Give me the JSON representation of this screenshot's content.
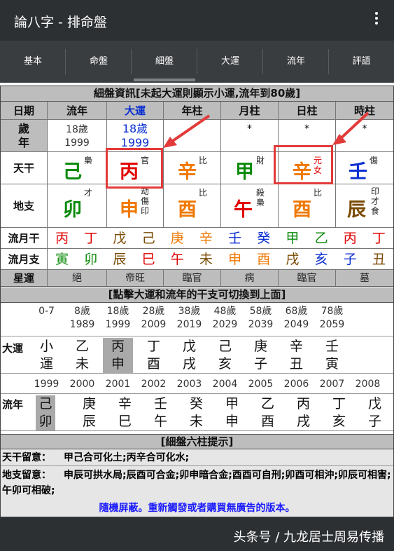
{
  "app": {
    "title": "論八字 - 排命盤"
  },
  "tabs": [
    "基本",
    "命盤",
    "細盤",
    "大運",
    "流年",
    "評語"
  ],
  "active_tab": 2,
  "detail": {
    "header": "細盤資訊[未起大運則顯示小運,流年到80歲]",
    "col_headers": [
      "日期",
      "流年",
      "大運",
      "年柱",
      "月柱",
      "日柱",
      "時柱"
    ],
    "age_row": {
      "label": "歲\n年",
      "liunian": "18歲\n1999",
      "dayun": "18歲\n1999",
      "year": "",
      "month": "*",
      "day": "*",
      "hour": "*"
    },
    "tiangan": {
      "label": "天干",
      "cells": [
        {
          "ch": "己",
          "sup": "梟",
          "color": "#0a8a0a"
        },
        {
          "ch": "丙",
          "sup": "官",
          "color": "#e00000"
        },
        {
          "ch": "辛",
          "sup": "比",
          "color": "#f07800"
        },
        {
          "ch": "甲",
          "sup": "財",
          "color": "#0a8a0a"
        },
        {
          "ch": "辛",
          "sup": "元\n女",
          "color": "#f07800"
        },
        {
          "ch": "壬",
          "sup": "傷",
          "color": "#0a2fd1"
        }
      ]
    },
    "dizhi": {
      "label": "地支",
      "cells": [
        {
          "ch": "卯",
          "sup": "才",
          "color": "#0a8a0a"
        },
        {
          "ch": "申",
          "sup": "劫\n傷\n印",
          "color": "#f07800"
        },
        {
          "ch": "酉",
          "sup": "比",
          "color": "#f07800"
        },
        {
          "ch": "午",
          "sup": "殺\n梟",
          "color": "#e00000"
        },
        {
          "ch": "酉",
          "sup": "比",
          "color": "#f07800"
        },
        {
          "ch": "辰",
          "sup": "印\n才\n食",
          "color": "#7a4a00"
        }
      ]
    },
    "liuyue_gan": {
      "label": "流月干",
      "items": [
        "丙",
        "丁",
        "戊",
        "己",
        "庚",
        "辛",
        "壬",
        "癸",
        "甲",
        "乙",
        "丙",
        "丁"
      ],
      "colors": [
        "#e00000",
        "#e00000",
        "#7a4a00",
        "#7a4a00",
        "#f07800",
        "#f07800",
        "#0a2fd1",
        "#0a2fd1",
        "#0a8a0a",
        "#0a8a0a",
        "#e00000",
        "#e00000"
      ]
    },
    "liuyue_zhi": {
      "label": "流月支",
      "items": [
        "寅",
        "卯",
        "辰",
        "巳",
        "午",
        "未",
        "申",
        "酉",
        "戌",
        "亥",
        "子",
        "丑"
      ],
      "colors": [
        "#0a8a0a",
        "#0a8a0a",
        "#7a4a00",
        "#e00000",
        "#e00000",
        "#7a4a00",
        "#f07800",
        "#f07800",
        "#7a4a00",
        "#0a2fd1",
        "#0a2fd1",
        "#7a4a00"
      ]
    },
    "xingyun": {
      "label": "星運",
      "items": [
        "絕",
        "帝旺",
        "臨官",
        "病",
        "臨官",
        "墓"
      ]
    }
  },
  "dayun": {
    "header": "[點擊大運和流年的干支可切換到上面]",
    "ages": [
      "0-7",
      "8歲\n1989",
      "18歲\n1999",
      "28歲\n2009",
      "38歲\n2019",
      "48歲\n2029",
      "58歲\n2039",
      "68歲\n2049",
      "78歲\n2059"
    ],
    "label": "大運",
    "pillars": [
      "小\n運",
      "乙\n未",
      "丙\n申",
      "丁\n酉",
      "戊\n戌",
      "己\n亥",
      "庚\n子",
      "辛\n丑",
      "壬\n寅"
    ],
    "selected": 2
  },
  "liunian": {
    "years": [
      "1999",
      "2000",
      "2001",
      "2002",
      "2003",
      "2004",
      "2005",
      "2006",
      "2007",
      "2008"
    ],
    "label": "流年",
    "pillars": [
      "己\n卯",
      "庚\n辰",
      "辛\n巳",
      "壬\n午",
      "癸\n未",
      "甲\n申",
      "乙\n酉",
      "丙\n戌",
      "丁\n亥",
      "戊\n子"
    ],
    "selected": 0
  },
  "tips": {
    "header": "[細盤六柱提示]",
    "tiangan_label": "天干留意：",
    "tiangan_text": "甲己合可化土;丙辛合可化水;",
    "dizhi_label": "地支留意：",
    "dizhi_text": "申辰可拱水局;辰酉可合金;卯申暗合金;酉酉可自刑;卯酉可相沖;卯辰可相害;午卯可相破;",
    "ad": "隨機屏蔽。重新觸發或者購買無廣告的版本。"
  },
  "watermark": "头条号 / 九龙居士周易传播"
}
